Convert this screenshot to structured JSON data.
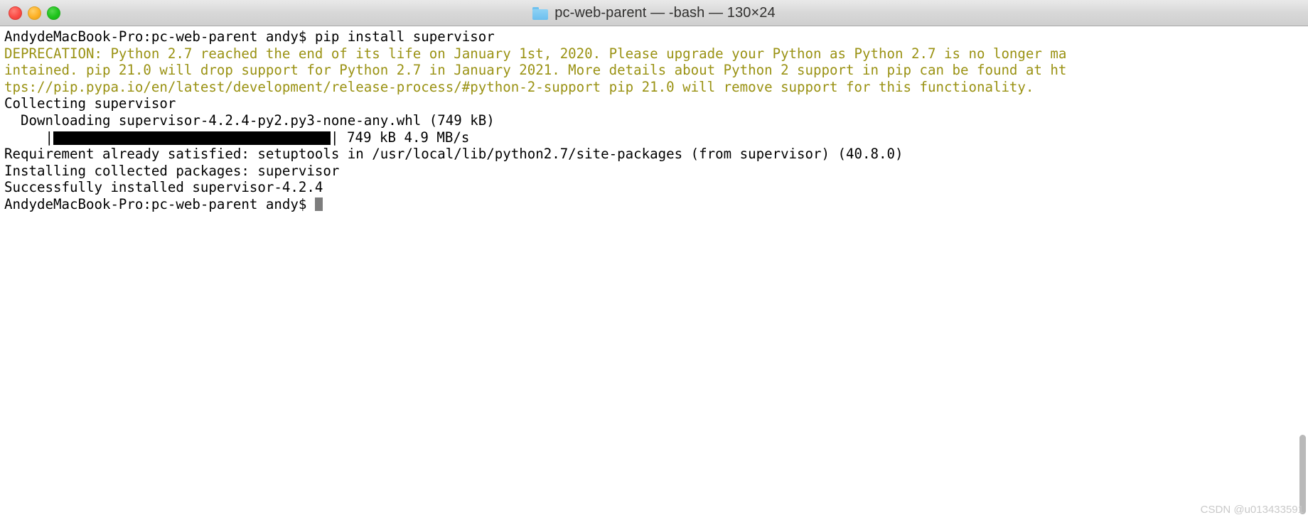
{
  "window": {
    "title": "pc-web-parent — -bash — 130×24",
    "folder_icon": "folder-icon",
    "controls": {
      "close_label": "close",
      "minimize_label": "minimize",
      "maximize_label": "maximize"
    }
  },
  "terminal": {
    "columns": 130,
    "rows": 24,
    "colors": {
      "background": "#ffffff",
      "foreground": "#000000",
      "warning": "#9a9213",
      "cursor": "#7d7d7d"
    },
    "lines": [
      {
        "kind": "prompt",
        "color": "normal",
        "text": "AndydeMacBook-Pro:pc-web-parent andy$ pip install supervisor"
      },
      {
        "kind": "output",
        "color": "warning",
        "text": "DEPRECATION: Python 2.7 reached the end of its life on January 1st, 2020. Please upgrade your Python as Python 2.7 is no longer ma"
      },
      {
        "kind": "output",
        "color": "warning",
        "text": "intained. pip 21.0 will drop support for Python 2.7 in January 2021. More details about Python 2 support in pip can be found at ht"
      },
      {
        "kind": "output",
        "color": "warning",
        "text": "tps://pip.pypa.io/en/latest/development/release-process/#python-2-support pip 21.0 will remove support for this functionality."
      },
      {
        "kind": "output",
        "color": "normal",
        "text": "Collecting supervisor"
      },
      {
        "kind": "output",
        "color": "normal",
        "text": "  Downloading supervisor-4.2.4-py2.py3-none-any.whl (749 kB)"
      },
      {
        "kind": "progress",
        "color": "normal",
        "prefix": "     |",
        "suffix": "| 749 kB 4.9 MB/s",
        "percent": 100,
        "size": "749 kB",
        "speed": "4.9 MB/s"
      },
      {
        "kind": "output",
        "color": "normal",
        "text": "Requirement already satisfied: setuptools in /usr/local/lib/python2.7/site-packages (from supervisor) (40.8.0)"
      },
      {
        "kind": "output",
        "color": "normal",
        "text": "Installing collected packages: supervisor"
      },
      {
        "kind": "output",
        "color": "normal",
        "text": "Successfully installed supervisor-4.2.4"
      },
      {
        "kind": "prompt_cursor",
        "color": "normal",
        "text": "AndydeMacBook-Pro:pc-web-parent andy$ "
      }
    ]
  },
  "watermark": {
    "text": "CSDN @u013433591"
  }
}
